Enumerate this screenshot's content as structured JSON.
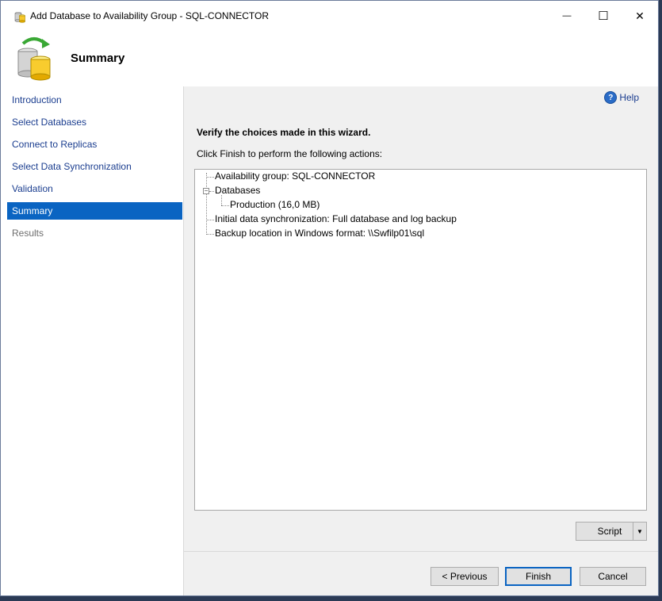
{
  "window": {
    "title": "Add Database to Availability Group - SQL-CONNECTOR",
    "minimize": "—",
    "maximize": "☐",
    "close": "✕"
  },
  "header": {
    "title": "Summary"
  },
  "nav": {
    "items": [
      {
        "label": "Introduction",
        "state": "link"
      },
      {
        "label": "Select Databases",
        "state": "link"
      },
      {
        "label": "Connect to Replicas",
        "state": "link"
      },
      {
        "label": "Select Data Synchronization",
        "state": "link"
      },
      {
        "label": "Validation",
        "state": "link"
      },
      {
        "label": "Summary",
        "state": "active"
      },
      {
        "label": "Results",
        "state": "disabled"
      }
    ]
  },
  "content": {
    "help_label": "Help",
    "help_glyph": "?",
    "verify_text": "Verify the choices made in this wizard.",
    "instruction_text": "Click Finish to perform the following actions:",
    "tree": {
      "availability_group": "Availability group: SQL-CONNECTOR",
      "databases": "Databases",
      "databases_expander": "−",
      "database_child": "Production (16,0 MB)",
      "sync": "Initial data synchronization: Full database and log backup",
      "backup": "Backup location in Windows format: \\\\Swfilp01\\sql"
    }
  },
  "buttons": {
    "script": "Script",
    "script_arrow": "▼",
    "previous": "< Previous",
    "finish": "Finish",
    "cancel": "Cancel"
  },
  "colors": {
    "accent": "#0a64c2",
    "link": "#1a3d8f",
    "panel_bg": "#f0f0f0"
  }
}
